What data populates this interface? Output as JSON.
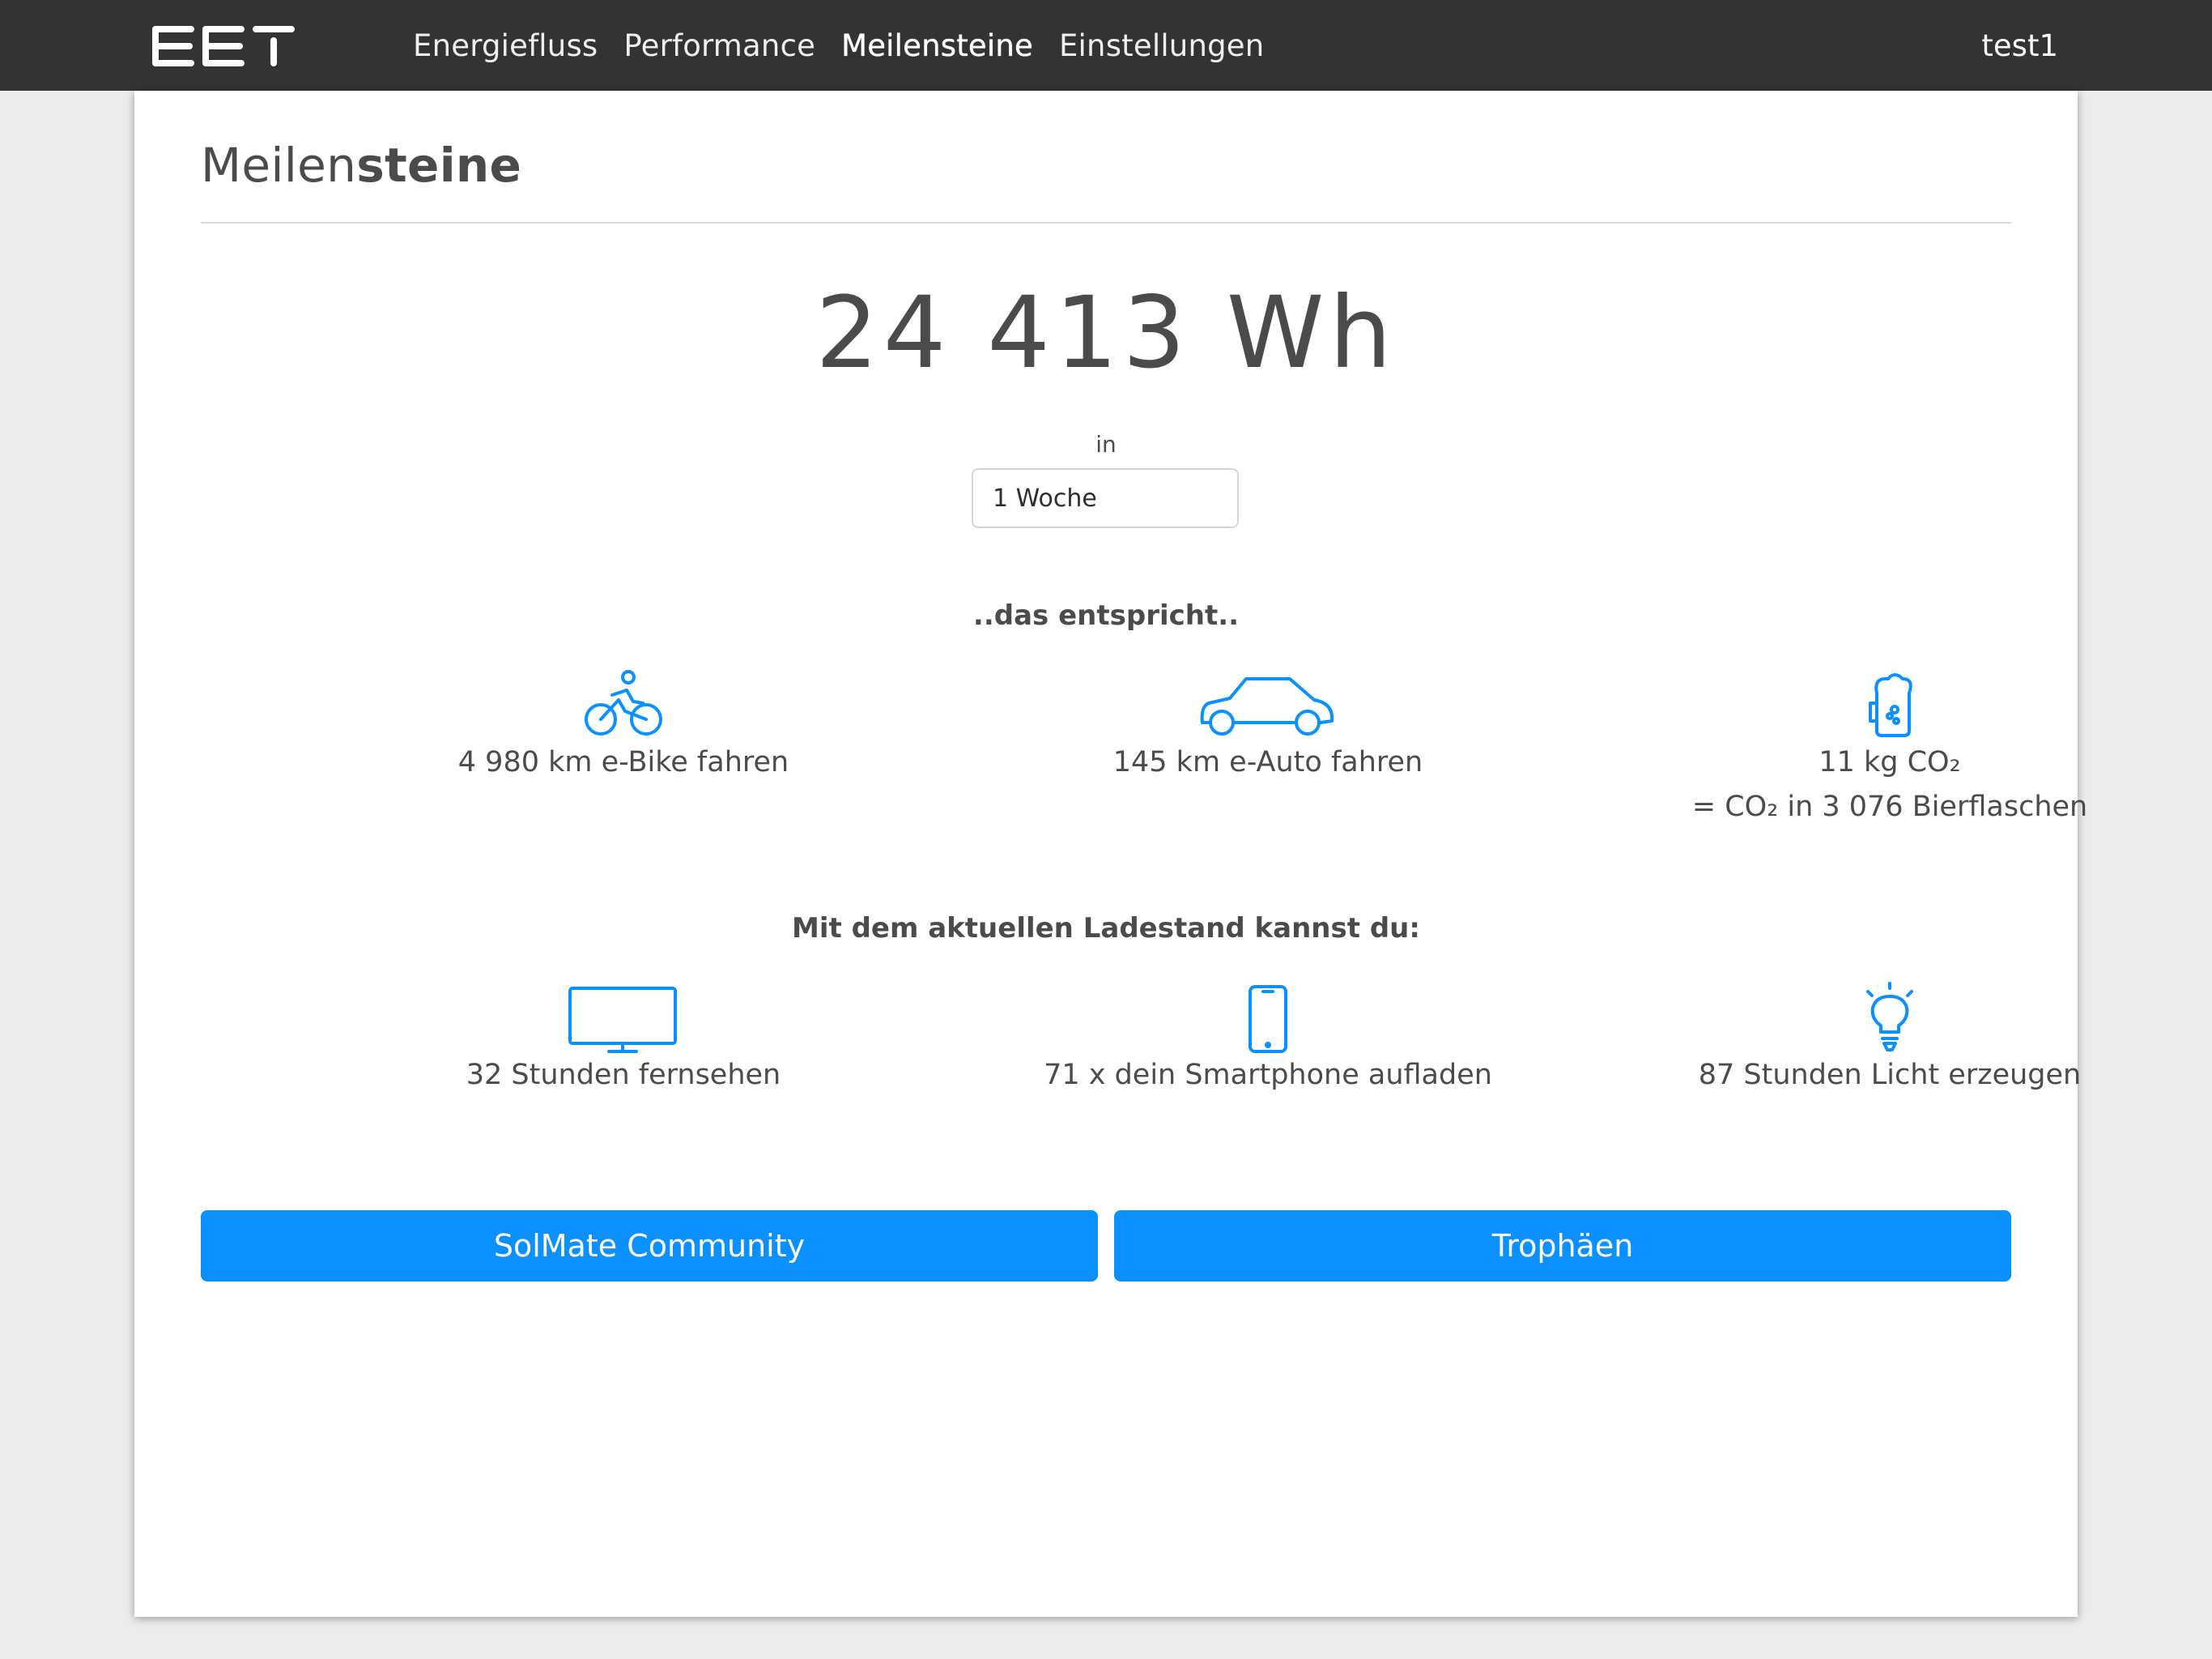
{
  "app": {
    "logo_text": "EET",
    "user": "test1",
    "accent_color": "#0a90ff"
  },
  "nav": {
    "items": [
      {
        "label": "Energiefluss",
        "active": false
      },
      {
        "label": "Performance",
        "active": false
      },
      {
        "label": "Meilensteine",
        "active": true
      },
      {
        "label": "Einstellungen",
        "active": false
      }
    ]
  },
  "page": {
    "title_light": "Meilen",
    "title_bold": "steine",
    "total_energy": "24 413 Wh",
    "in_label": "in",
    "period_select": {
      "value": "1 Woche"
    },
    "equivalent_heading": "..das entspricht..",
    "equivalents": [
      {
        "icon": "bicycle-icon",
        "text": "4 980 km e-Bike fahren"
      },
      {
        "icon": "car-icon",
        "text": "145 km e-Auto fahren"
      },
      {
        "icon": "beer-mug-icon",
        "text": "11 kg CO₂",
        "subtext": "= CO₂ in 3 076 Bierflaschen"
      }
    ],
    "charge_heading": "Mit dem aktuellen Ladestand kannst du:",
    "charge_items": [
      {
        "icon": "tv-icon",
        "text": "32 Stunden fernsehen"
      },
      {
        "icon": "smartphone-icon",
        "text": "71 x dein Smartphone aufladen"
      },
      {
        "icon": "lightbulb-icon",
        "text": "87 Stunden Licht erzeugen"
      }
    ],
    "buttons": {
      "community": "SolMate Community",
      "trophies": "Trophäen"
    }
  }
}
